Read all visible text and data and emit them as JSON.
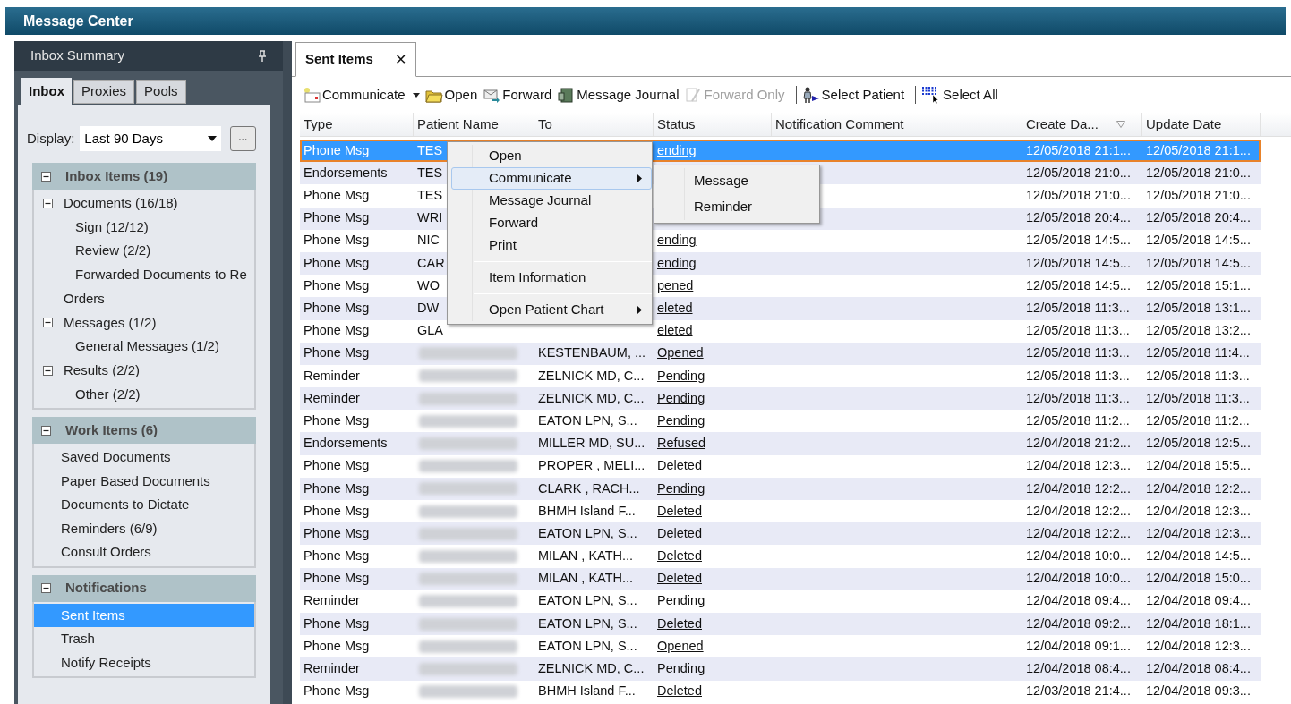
{
  "window": {
    "title": "Message Center"
  },
  "sidebar": {
    "title": "Inbox Summary",
    "tabs": [
      {
        "label": "Inbox",
        "selected": true
      },
      {
        "label": "Proxies",
        "selected": false
      },
      {
        "label": "Pools",
        "selected": false
      }
    ],
    "display": {
      "label": "Display:",
      "value": "Last 90 Days",
      "more_button": "..."
    },
    "sections": [
      {
        "title": "Inbox Items (19)",
        "expanded": true,
        "items": [
          {
            "label": "Documents (16/18)",
            "expanded": true,
            "selected": false,
            "children": [
              {
                "label": "Sign (12/12)",
                "selected": false
              },
              {
                "label": "Review (2/2)",
                "selected": false
              },
              {
                "label": "Forwarded Documents to Re",
                "selected": false
              }
            ]
          },
          {
            "label": "Orders",
            "selected": false
          },
          {
            "label": "Messages (1/2)",
            "expanded": true,
            "selected": false,
            "children": [
              {
                "label": "General Messages (1/2)",
                "selected": false
              }
            ]
          },
          {
            "label": "Results (2/2)",
            "expanded": true,
            "selected": false,
            "children": [
              {
                "label": "Other (2/2)",
                "selected": false
              }
            ]
          }
        ]
      },
      {
        "title": "Work Items (6)",
        "expanded": true,
        "items": [
          {
            "label": "Saved Documents",
            "selected": false
          },
          {
            "label": "Paper Based Documents",
            "selected": false
          },
          {
            "label": "Documents to Dictate",
            "selected": false
          },
          {
            "label": "Reminders (6/9)",
            "selected": false
          },
          {
            "label": "Consult Orders",
            "selected": false
          }
        ]
      },
      {
        "title": "Notifications",
        "expanded": true,
        "items": [
          {
            "label": "Sent Items",
            "selected": true
          },
          {
            "label": "Trash",
            "selected": false
          },
          {
            "label": "Notify Receipts",
            "selected": false
          }
        ]
      }
    ]
  },
  "document_tab": {
    "label": "Sent Items",
    "close": "✕"
  },
  "toolbar": {
    "groups": [
      {
        "items": [
          {
            "kind": "communicate",
            "label": "Communicate",
            "dropdown": true,
            "disabled": false
          },
          {
            "kind": "open",
            "label": "Open",
            "dropdown": false,
            "disabled": false
          },
          {
            "kind": "forward",
            "label": "Forward",
            "dropdown": false,
            "disabled": false
          },
          {
            "kind": "journal",
            "label": "Message Journal",
            "dropdown": false,
            "disabled": false
          },
          {
            "kind": "forward_only",
            "label": "Forward Only",
            "dropdown": false,
            "disabled": true
          }
        ]
      },
      {
        "items": [
          {
            "kind": "select_patient",
            "label": "Select Patient",
            "dropdown": false,
            "disabled": false
          }
        ]
      },
      {
        "items": [
          {
            "kind": "select_all",
            "label": "Select All",
            "dropdown": false,
            "disabled": false
          }
        ]
      }
    ]
  },
  "table": {
    "columns": [
      {
        "label": "Type",
        "sorted": false
      },
      {
        "label": "Patient Name",
        "sorted": false
      },
      {
        "label": "To",
        "sorted": false
      },
      {
        "label": "Status",
        "sorted": false
      },
      {
        "label": "Notification Comment",
        "sorted": false
      },
      {
        "label": "Create Da...",
        "sorted": true
      },
      {
        "label": "Update Date",
        "sorted": false
      }
    ],
    "rows": [
      {
        "type": "Phone Msg",
        "patient": "TES",
        "to": "",
        "status": "ending",
        "created": "12/05/2018 21:1...",
        "updated": "12/05/2018 21:1...",
        "selected": true
      },
      {
        "type": "Endorsements",
        "patient": "TES",
        "to": "",
        "status": "",
        "created": "12/05/2018 21:0...",
        "updated": "12/05/2018 21:0...",
        "selected": false
      },
      {
        "type": "Phone Msg",
        "patient": "TES",
        "to": "",
        "status": "",
        "created": "12/05/2018 21:0...",
        "updated": "12/05/2018 21:0...",
        "selected": false
      },
      {
        "type": "Phone Msg",
        "patient": "WRI",
        "to": "",
        "status": "",
        "created": "12/05/2018 20:4...",
        "updated": "12/05/2018 20:4...",
        "selected": false
      },
      {
        "type": "Phone Msg",
        "patient": "NIC",
        "to": "",
        "status": "ending",
        "created": "12/05/2018 14:5...",
        "updated": "12/05/2018 14:5...",
        "selected": false
      },
      {
        "type": "Phone Msg",
        "patient": "CAR",
        "to": "",
        "status": "ending",
        "created": "12/05/2018 14:5...",
        "updated": "12/05/2018 14:5...",
        "selected": false
      },
      {
        "type": "Phone Msg",
        "patient": "WO",
        "to": "",
        "status": "pened",
        "created": "12/05/2018 14:5...",
        "updated": "12/05/2018 15:1...",
        "selected": false
      },
      {
        "type": "Phone Msg",
        "patient": "DW",
        "to": "",
        "status": "eleted",
        "created": "12/05/2018 11:3...",
        "updated": "12/05/2018 13:1...",
        "selected": false
      },
      {
        "type": "Phone Msg",
        "patient": "GLA",
        "to": "",
        "status": "eleted",
        "created": "12/05/2018 11:3...",
        "updated": "12/05/2018 13:2...",
        "selected": false
      },
      {
        "type": "Phone Msg",
        "to": "KESTENBAUM, ...",
        "status": "Opened",
        "created": "12/05/2018 11:3...",
        "updated": "12/05/2018 11:4...",
        "selected": false
      },
      {
        "type": "Reminder",
        "to": "ZELNICK MD, C...",
        "status": "Pending",
        "created": "12/05/2018 11:3...",
        "updated": "12/05/2018 11:3...",
        "selected": false
      },
      {
        "type": "Reminder",
        "to": "ZELNICK MD, C...",
        "status": "Pending",
        "created": "12/05/2018 11:3...",
        "updated": "12/05/2018 11:3...",
        "selected": false
      },
      {
        "type": "Phone Msg",
        "to": "EATON LPN, S...",
        "status": "Pending",
        "created": "12/05/2018 11:2...",
        "updated": "12/05/2018 11:2...",
        "selected": false
      },
      {
        "type": "Endorsements",
        "to": "MILLER MD, SU...",
        "status": "Refused",
        "created": "12/04/2018 21:2...",
        "updated": "12/05/2018 12:5...",
        "selected": false
      },
      {
        "type": "Phone Msg",
        "to": "PROPER , MELI...",
        "status": "Deleted",
        "created": "12/04/2018 12:3...",
        "updated": "12/04/2018 15:5...",
        "selected": false
      },
      {
        "type": "Phone Msg",
        "to": "CLARK , RACH...",
        "status": "Pending",
        "created": "12/04/2018 12:2...",
        "updated": "12/04/2018 12:2...",
        "selected": false
      },
      {
        "type": "Phone Msg",
        "to": "BHMH Island F...",
        "status": "Deleted",
        "created": "12/04/2018 12:2...",
        "updated": "12/04/2018 12:3...",
        "selected": false
      },
      {
        "type": "Phone Msg",
        "to": "EATON LPN, S...",
        "status": "Deleted",
        "created": "12/04/2018 12:2...",
        "updated": "12/04/2018 12:3...",
        "selected": false
      },
      {
        "type": "Phone Msg",
        "to": "MILAN , KATH...",
        "status": "Deleted",
        "created": "12/04/2018 10:0...",
        "updated": "12/04/2018 14:5...",
        "selected": false
      },
      {
        "type": "Phone Msg",
        "to": "MILAN , KATH...",
        "status": "Deleted",
        "created": "12/04/2018 10:0...",
        "updated": "12/04/2018 15:0...",
        "selected": false
      },
      {
        "type": "Reminder",
        "to": "EATON LPN, S...",
        "status": "Pending",
        "created": "12/04/2018 09:4...",
        "updated": "12/04/2018 09:4...",
        "selected": false
      },
      {
        "type": "Phone Msg",
        "to": "EATON LPN, S...",
        "status": "Deleted",
        "created": "12/04/2018 09:2...",
        "updated": "12/04/2018 18:1...",
        "selected": false
      },
      {
        "type": "Phone Msg",
        "to": "EATON LPN, S...",
        "status": "Opened",
        "created": "12/04/2018 09:1...",
        "updated": "12/04/2018 12:3...",
        "selected": false
      },
      {
        "type": "Reminder",
        "to": "ZELNICK MD, C...",
        "status": "Pending",
        "created": "12/04/2018 08:4...",
        "updated": "12/04/2018 08:4...",
        "selected": false
      },
      {
        "type": "Phone Msg",
        "to": "BHMH Island F...",
        "status": "Deleted",
        "created": "12/03/2018 21:4...",
        "updated": "12/04/2018 09:3...",
        "selected": false
      }
    ]
  },
  "context_menu": {
    "groups": [
      {
        "items": [
          {
            "label": "Open",
            "submenu": false,
            "highlighted": false
          },
          {
            "label": "Communicate",
            "submenu": true,
            "highlighted": true
          },
          {
            "label": "Message Journal",
            "submenu": false,
            "highlighted": false
          },
          {
            "label": "Forward",
            "submenu": false,
            "highlighted": false
          },
          {
            "label": "Print",
            "submenu": false,
            "highlighted": false
          }
        ]
      },
      {
        "items": [
          {
            "label": "Item Information",
            "submenu": false,
            "highlighted": false
          }
        ]
      },
      {
        "items": [
          {
            "label": "Open Patient Chart",
            "submenu": true,
            "highlighted": false
          }
        ]
      }
    ],
    "submenu": {
      "items": [
        {
          "label": "Message"
        },
        {
          "label": "Reminder"
        }
      ]
    }
  }
}
